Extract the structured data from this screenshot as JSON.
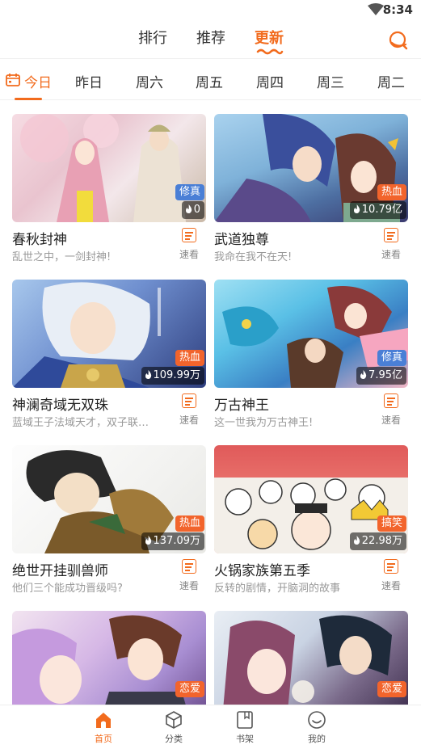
{
  "status_bar": {
    "time": "8:34"
  },
  "top_tabs": [
    {
      "label": "排行"
    },
    {
      "label": "推荐"
    },
    {
      "label": "更新"
    }
  ],
  "day_tabs": [
    {
      "label": "今日"
    },
    {
      "label": "昨日"
    },
    {
      "label": "周六"
    },
    {
      "label": "周五"
    },
    {
      "label": "周四"
    },
    {
      "label": "周三"
    },
    {
      "label": "周二"
    }
  ],
  "quick_read_label": "速看",
  "comics": [
    {
      "title": "春秋封神",
      "desc": "乱世之中，一剑封神!",
      "tag": "修真",
      "heat": "0"
    },
    {
      "title": "武道独尊",
      "desc": "我命在我不在天!",
      "tag": "热血",
      "heat": "10.79亿"
    },
    {
      "title": "神澜奇域无双珠",
      "desc": "蓝域王子法域天才，双子联…",
      "tag": "热血",
      "heat": "109.99万"
    },
    {
      "title": "万古神王",
      "desc": "这一世我为万古神王!",
      "tag": "修真",
      "heat": "7.95亿"
    },
    {
      "title": "绝世开挂驯兽师",
      "desc": "他们三个能成功晋级吗?",
      "tag": "热血",
      "heat": "137.09万"
    },
    {
      "title": "火锅家族第五季",
      "desc": "反转的剧情，开脑洞的故事",
      "tag": "搞笑",
      "heat": "22.98万"
    },
    {
      "tag": "恋爱"
    },
    {
      "tag": "恋爱"
    }
  ],
  "colors": {
    "accent": "#f26b1d",
    "tag_xiuzhen": "#4a7fd6",
    "tag_rexue": "#f2642c",
    "tag_gaoxiao": "#f2642c",
    "tag_lianai": "#f2642c"
  },
  "bottom_nav": [
    {
      "label": "首页",
      "icon": "home-icon"
    },
    {
      "label": "分类",
      "icon": "cube-icon"
    },
    {
      "label": "书架",
      "icon": "bookshelf-icon"
    },
    {
      "label": "我的",
      "icon": "profile-icon"
    }
  ]
}
